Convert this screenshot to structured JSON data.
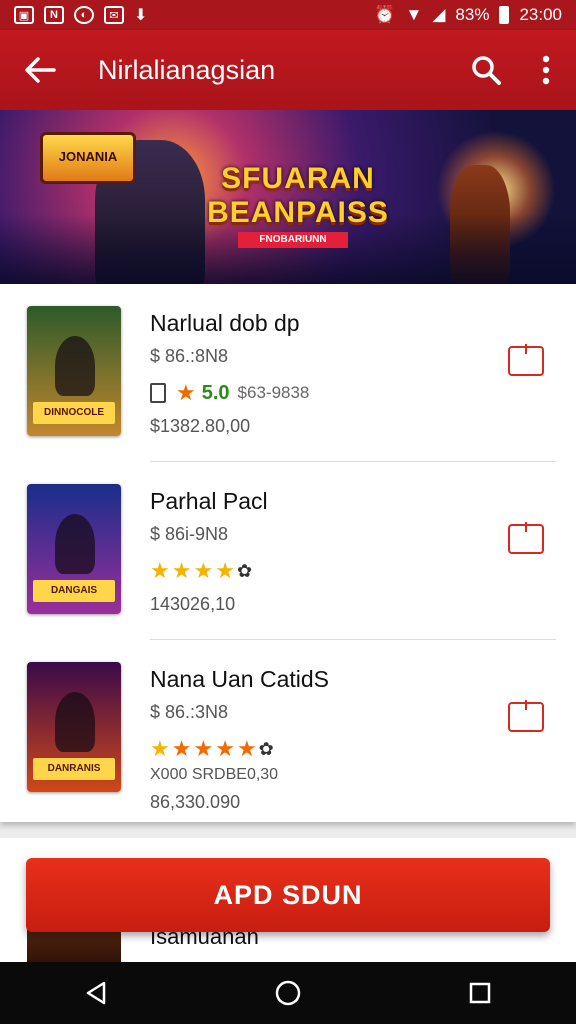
{
  "status_bar": {
    "left_icons": [
      "gallery-icon",
      "notification-n-icon",
      "whatsapp-icon",
      "mail-icon",
      "download-icon"
    ],
    "battery": "83%",
    "time": "23:00"
  },
  "app_bar": {
    "title": "Nirlalianagsian",
    "back_icon": "arrow-left-icon",
    "search_icon": "search-icon",
    "menu_icon": "more-vert-icon"
  },
  "banner": {
    "small_logo": "JONANIA",
    "title_line1": "SFUARAN",
    "title_line2": "BEANPAISS",
    "subtitle": "FNOBARIUNN"
  },
  "items": [
    {
      "name": "Narlual dob dp",
      "price": "$ 86.:8N8",
      "score": "5.0",
      "count": "$63-9838",
      "extra": "$1382.80,00",
      "cover_text": "DINNOCOLE",
      "colors": [
        "#2e5a2a",
        "#c2872e"
      ]
    },
    {
      "name": "Parhal Pacl",
      "price": "$ 86i-9N8",
      "stars": 4,
      "extra": "143026,10",
      "cover_text": "DANGAIS",
      "colors": [
        "#1a2e8a",
        "#9a2f9a"
      ]
    },
    {
      "name": "Nana Uan CatidS",
      "price": "$ 86.:3N8",
      "stars": 5,
      "extra": "X000 SRDBE0,30",
      "extra2": "86,330.090",
      "cover_text": "DANRANIS",
      "colors": [
        "#3a0a4a",
        "#d0471a"
      ]
    }
  ],
  "peek_text": "Isamuanan",
  "cta_label": "APD SDUN",
  "nav": [
    "back-triangle-icon",
    "home-circle-icon",
    "recents-square-icon"
  ],
  "colors": {
    "primary": "#c2191f",
    "cta": "#e8301a"
  }
}
